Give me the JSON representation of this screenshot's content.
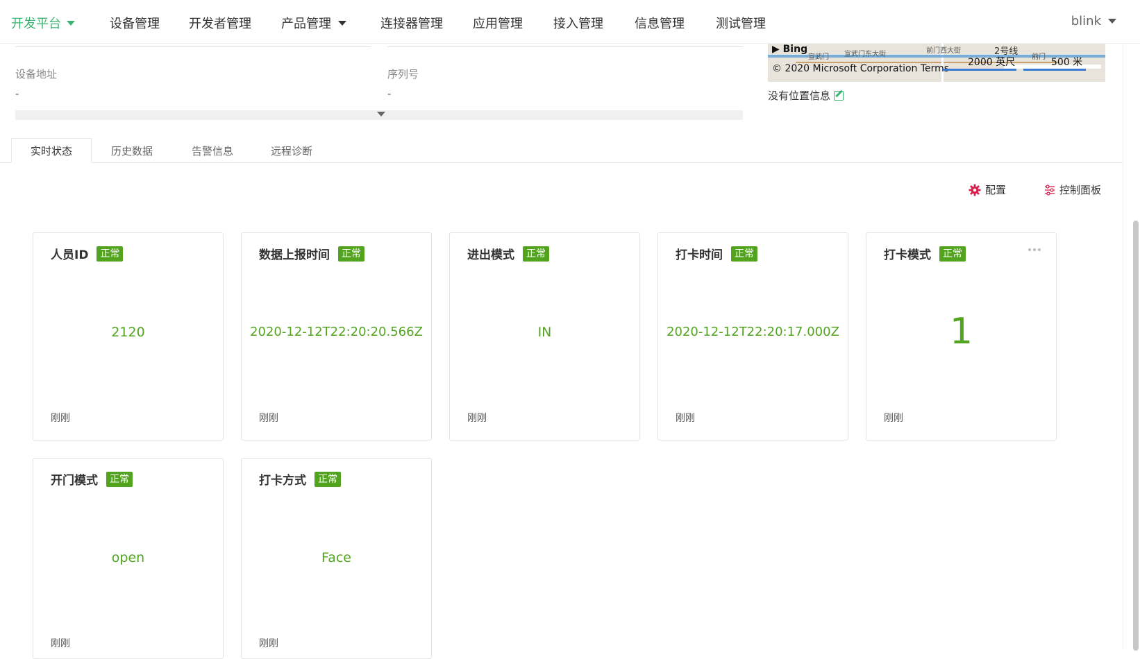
{
  "nav": {
    "brand": "开发平台",
    "items": [
      {
        "label": "设备管理",
        "has_dropdown": false
      },
      {
        "label": "开发者管理",
        "has_dropdown": false
      },
      {
        "label": "产品管理",
        "has_dropdown": true
      },
      {
        "label": "连接器管理",
        "has_dropdown": false
      },
      {
        "label": "应用管理",
        "has_dropdown": false
      },
      {
        "label": "接入管理",
        "has_dropdown": false
      },
      {
        "label": "信息管理",
        "has_dropdown": false
      },
      {
        "label": "测试管理",
        "has_dropdown": false
      }
    ],
    "user": "blink"
  },
  "info": {
    "address_label": "设备地址",
    "address_value": "-",
    "serial_label": "序列号",
    "serial_value": "-"
  },
  "map": {
    "bing": "Bing",
    "copyright": "© 2020 Microsoft Corporation",
    "terms": "Terms",
    "scale_imperial": "2000 英尺",
    "scale_metric": "500 米",
    "labels": [
      "宣武门",
      "宣武门东大街",
      "前门西大街",
      "2号线",
      "前门"
    ],
    "no_location": "没有位置信息"
  },
  "tabs": [
    {
      "label": "实时状态",
      "active": true
    },
    {
      "label": "历史数据",
      "active": false
    },
    {
      "label": "告警信息",
      "active": false
    },
    {
      "label": "远程诊断",
      "active": false
    }
  ],
  "actions": {
    "config": "配置",
    "control_panel": "控制面板"
  },
  "cards": [
    {
      "title": "人员ID",
      "status": "正常",
      "value": "2120",
      "time": "刚刚"
    },
    {
      "title": "数据上报时间",
      "status": "正常",
      "value": "2020-12-12T22:20:20.566Z",
      "time": "刚刚"
    },
    {
      "title": "进出模式",
      "status": "正常",
      "value": "IN",
      "time": "刚刚"
    },
    {
      "title": "打卡时间",
      "status": "正常",
      "value": "2020-12-12T22:20:17.000Z",
      "time": "刚刚"
    },
    {
      "title": "打卡模式",
      "status": "正常",
      "value": "1",
      "time": "刚刚"
    },
    {
      "title": "开门模式",
      "status": "正常",
      "value": "open",
      "time": "刚刚"
    },
    {
      "title": "打卡方式",
      "status": "正常",
      "value": "Face",
      "time": "刚刚"
    }
  ],
  "colors": {
    "brand": "#3cb371",
    "status_ok": "#52a41f",
    "config_icon": "#d81e4a"
  }
}
